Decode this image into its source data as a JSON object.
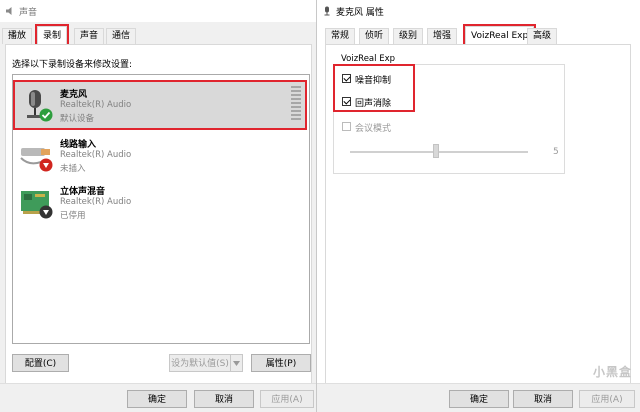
{
  "left_window": {
    "title": "声音",
    "tabs": [
      {
        "label": "播放",
        "active": false
      },
      {
        "label": "录制",
        "active": true
      },
      {
        "label": "声音",
        "active": false
      },
      {
        "label": "通信",
        "active": false
      }
    ],
    "instruction": "选择以下录制设备来修改设置:",
    "devices": [
      {
        "name": "麦克风",
        "driver": "Realtek(R) Audio",
        "status": "默认设备",
        "icon": "microphone-icon",
        "badge": "default-check-icon",
        "selected": true
      },
      {
        "name": "线路输入",
        "driver": "Realtek(R) Audio",
        "status": "未插入",
        "icon": "line-in-icon",
        "badge": "unplugged-arrow-icon",
        "selected": false
      },
      {
        "name": "立体声混音",
        "driver": "Realtek(R) Audio",
        "status": "已停用",
        "icon": "stereo-mix-icon",
        "badge": "disabled-arrow-icon",
        "selected": false
      }
    ],
    "buttons": {
      "configure": "配置(C)",
      "set_default": "设为默认值(S)",
      "properties": "属性(P)"
    },
    "footer": {
      "ok": "确定",
      "cancel": "取消",
      "apply": "应用(A)"
    }
  },
  "right_window": {
    "title": "麦克风 属性",
    "tabs": [
      {
        "label": "常规",
        "active": false
      },
      {
        "label": "侦听",
        "active": false
      },
      {
        "label": "级别",
        "active": false
      },
      {
        "label": "增强",
        "active": false
      },
      {
        "label": "VoizReal Exp",
        "active": true
      },
      {
        "label": "高级",
        "active": false
      }
    ],
    "group_title": "VoizReal Exp",
    "options": [
      {
        "label": "噪音抑制",
        "checked": true,
        "enabled": true
      },
      {
        "label": "回声消除",
        "checked": true,
        "enabled": true
      },
      {
        "label": "会议模式",
        "checked": false,
        "enabled": false
      }
    ],
    "slider": {
      "end_label": "5"
    },
    "footer": {
      "ok": "确定",
      "cancel": "取消",
      "apply": "应用(A)"
    }
  },
  "watermark": "小黑盒",
  "colors": {
    "highlight": "#e0252e",
    "selected_row": "#d9d9d9",
    "default_check": "#2e9e3e",
    "status_arrow": "#d1261f"
  }
}
